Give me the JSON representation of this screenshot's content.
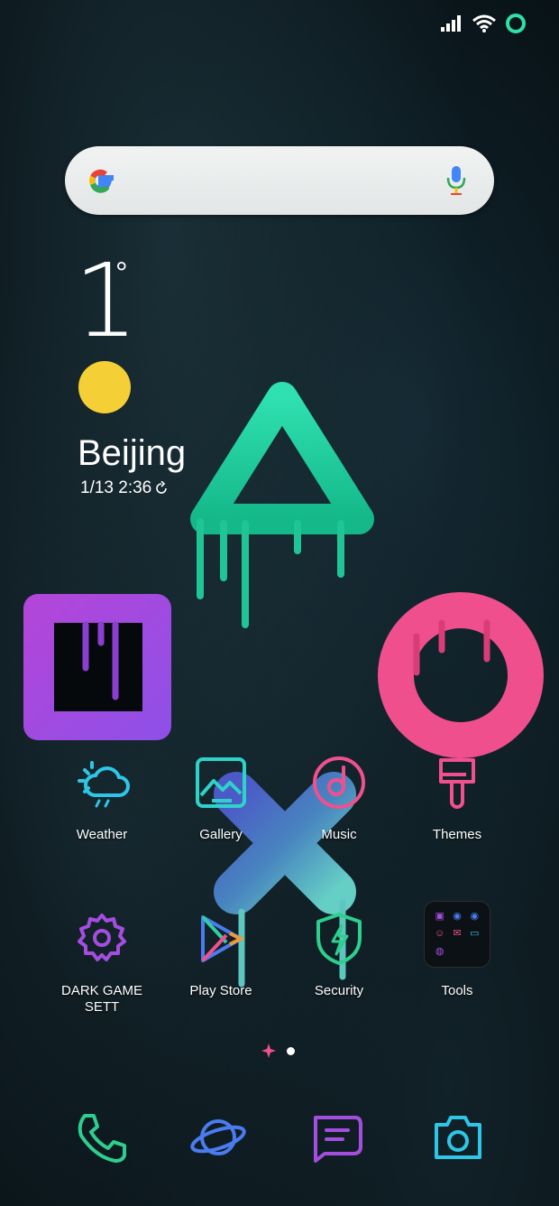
{
  "status_bar": {
    "icons": [
      "signal-icon",
      "wifi-icon",
      "battery-ring-icon"
    ]
  },
  "search": {
    "logo": "google-g-icon",
    "mic": "microphone-icon"
  },
  "weather_widget": {
    "temperature": "1",
    "degree": "°",
    "condition_icon": "sun-icon",
    "city": "Beijing",
    "datetime": "1/13 2:36"
  },
  "apps": [
    {
      "label": "Weather",
      "icon": "weather-cloud-icon"
    },
    {
      "label": "Gallery",
      "icon": "gallery-icon"
    },
    {
      "label": "Music",
      "icon": "music-icon"
    },
    {
      "label": "Themes",
      "icon": "themes-brush-icon"
    },
    {
      "label": "DARK GAME SETT",
      "icon": "settings-gear-icon"
    },
    {
      "label": "Play Store",
      "icon": "play-store-icon"
    },
    {
      "label": "Security",
      "icon": "security-shield-icon"
    },
    {
      "label": "Tools",
      "icon": "tools-folder-icon"
    }
  ],
  "page_indicator": {
    "pages": 2,
    "current": 2
  },
  "dock": [
    "phone-icon",
    "browser-planet-icon",
    "messages-icon",
    "camera-icon"
  ],
  "colors": {
    "teal": "#1fd6a3",
    "purple": "#a44ee0",
    "pink": "#f0508e",
    "cyan": "#2ec6e6",
    "sun": "#f4cf35"
  }
}
